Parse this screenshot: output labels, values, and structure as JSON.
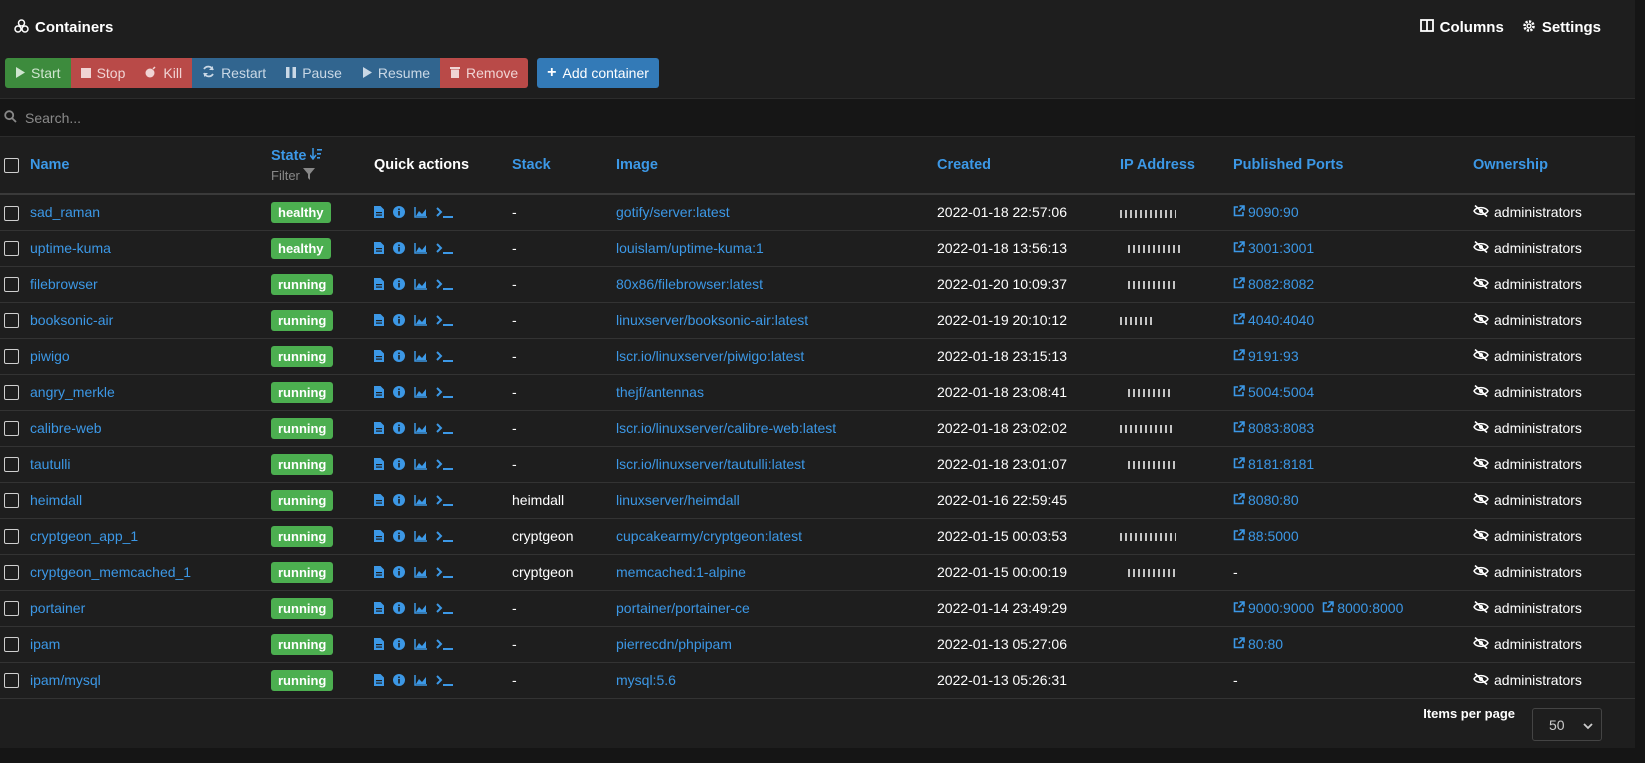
{
  "header": {
    "title": "Containers",
    "columns_label": "Columns",
    "settings_label": "Settings"
  },
  "toolbar": {
    "start": "Start",
    "stop": "Stop",
    "kill": "Kill",
    "restart": "Restart",
    "pause": "Pause",
    "resume": "Resume",
    "remove": "Remove",
    "add": "Add container"
  },
  "search": {
    "placeholder": "Search..."
  },
  "columns": {
    "name": "Name",
    "state": "State",
    "filter": "Filter",
    "quick_actions": "Quick actions",
    "stack": "Stack",
    "image": "Image",
    "created": "Created",
    "ip": "IP Address",
    "ports": "Published Ports",
    "ownership": "Ownership"
  },
  "rows": [
    {
      "name": "sad_raman",
      "state": "healthy",
      "stack": "-",
      "image": "gotify/server:latest",
      "created": "2022-01-18 22:57:06",
      "ports": [
        "9090:90"
      ],
      "ownership": "administrators"
    },
    {
      "name": "uptime-kuma",
      "state": "healthy",
      "stack": "-",
      "image": "louislam/uptime-kuma:1",
      "created": "2022-01-18 13:56:13",
      "ports": [
        "3001:3001"
      ],
      "ownership": "administrators"
    },
    {
      "name": "filebrowser",
      "state": "running",
      "stack": "-",
      "image": "80x86/filebrowser:latest",
      "created": "2022-01-20 10:09:37",
      "ports": [
        "8082:8082"
      ],
      "ownership": "administrators"
    },
    {
      "name": "booksonic-air",
      "state": "running",
      "stack": "-",
      "image": "linuxserver/booksonic-air:latest",
      "created": "2022-01-19 20:10:12",
      "ports": [
        "4040:4040"
      ],
      "ownership": "administrators"
    },
    {
      "name": "piwigo",
      "state": "running",
      "stack": "-",
      "image": "lscr.io/linuxserver/piwigo:latest",
      "created": "2022-01-18 23:15:13",
      "ports": [
        "9191:93"
      ],
      "ownership": "administrators"
    },
    {
      "name": "angry_merkle",
      "state": "running",
      "stack": "-",
      "image": "thejf/antennas",
      "created": "2022-01-18 23:08:41",
      "ports": [
        "5004:5004"
      ],
      "ownership": "administrators"
    },
    {
      "name": "calibre-web",
      "state": "running",
      "stack": "-",
      "image": "lscr.io/linuxserver/calibre-web:latest",
      "created": "2022-01-18 23:02:02",
      "ports": [
        "8083:8083"
      ],
      "ownership": "administrators"
    },
    {
      "name": "tautulli",
      "state": "running",
      "stack": "-",
      "image": "lscr.io/linuxserver/tautulli:latest",
      "created": "2022-01-18 23:01:07",
      "ports": [
        "8181:8181"
      ],
      "ownership": "administrators"
    },
    {
      "name": "heimdall",
      "state": "running",
      "stack": "heimdall",
      "image": "linuxserver/heimdall",
      "created": "2022-01-16 22:59:45",
      "ports": [
        "8080:80"
      ],
      "ownership": "administrators"
    },
    {
      "name": "cryptgeon_app_1",
      "state": "running",
      "stack": "cryptgeon",
      "image": "cupcakearmy/cryptgeon:latest",
      "created": "2022-01-15 00:03:53",
      "ports": [
        "88:5000"
      ],
      "ownership": "administrators"
    },
    {
      "name": "cryptgeon_memcached_1",
      "state": "running",
      "stack": "cryptgeon",
      "image": "memcached:1-alpine",
      "created": "2022-01-15 00:00:19",
      "ports": [],
      "ownership": "administrators"
    },
    {
      "name": "portainer",
      "state": "running",
      "stack": "-",
      "image": "portainer/portainer-ce",
      "created": "2022-01-14 23:49:29",
      "ports": [
        "9000:9000",
        "8000:8000"
      ],
      "ownership": "administrators"
    },
    {
      "name": "ipam",
      "state": "running",
      "stack": "-",
      "image": "pierrecdn/phpipam",
      "created": "2022-01-13 05:27:06",
      "ports": [
        "80:80"
      ],
      "ownership": "administrators"
    },
    {
      "name": "ipam/mysql",
      "state": "running",
      "stack": "-",
      "image": "mysql:5.6",
      "created": "2022-01-13 05:26:31",
      "ports": [],
      "ownership": "administrators"
    }
  ],
  "no_ports": "-",
  "footer": {
    "items_per_page_label": "Items per page",
    "items_per_page_value": "50"
  },
  "colors": {
    "link": "#3c98e6",
    "healthy": "#4caf50",
    "primary": "#337ab7",
    "danger": "#b94a48",
    "success": "#3d8b3d"
  }
}
